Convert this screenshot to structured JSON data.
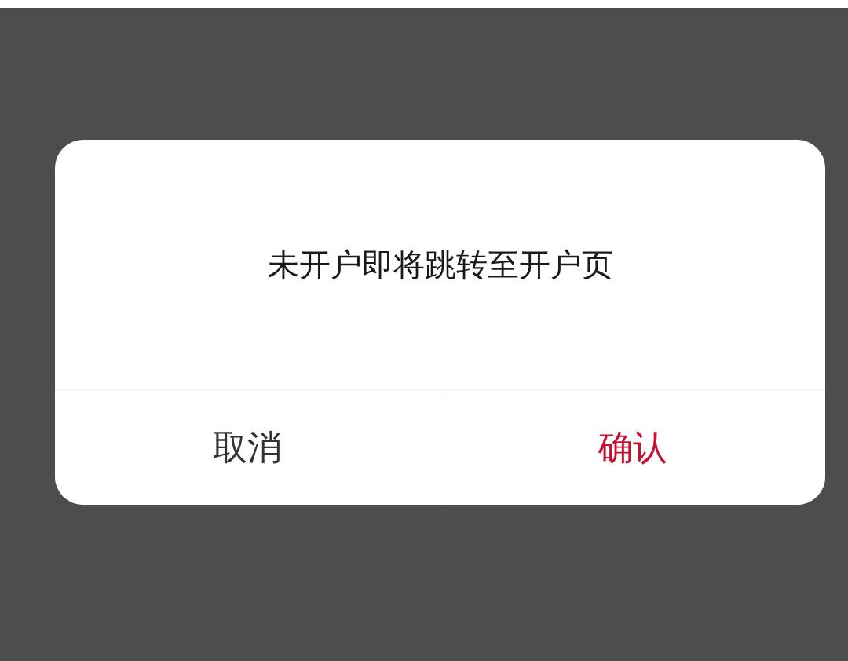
{
  "dialog": {
    "message": "未开户即将跳转至开户页",
    "buttons": [
      {
        "label": "取消",
        "kind": "cancel"
      },
      {
        "label": "确认",
        "kind": "confirm"
      }
    ]
  }
}
